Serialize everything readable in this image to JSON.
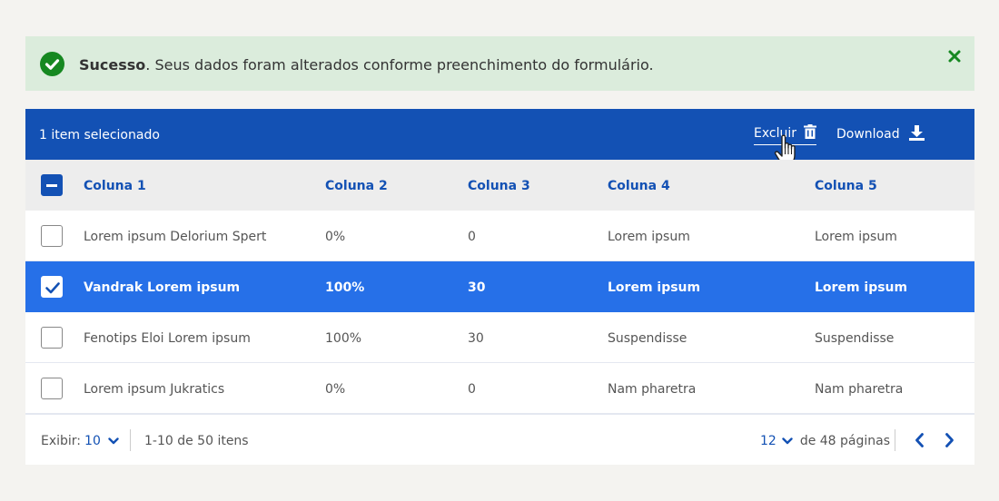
{
  "alert": {
    "title": "Sucesso",
    "message": ". Seus dados foram alterados conforme preenchimento do formulário."
  },
  "toolbar": {
    "selected_text": "1 item selecionado",
    "delete_label": "Excluir",
    "download_label": "Download"
  },
  "table": {
    "headers": [
      "Coluna 1",
      "Coluna 2",
      "Coluna 3",
      "Coluna 4",
      "Coluna 5"
    ],
    "rows": [
      {
        "cells": [
          "Lorem ipsum Delorium Spert",
          "0%",
          "0",
          "Lorem ipsum",
          "Lorem ipsum"
        ],
        "selected": false
      },
      {
        "cells": [
          "Vandrak Lorem ipsum",
          "100%",
          "30",
          "Lorem ipsum",
          "Lorem ipsum"
        ],
        "selected": true
      },
      {
        "cells": [
          "Fenotips Eloi Lorem ipsum",
          "100%",
          "30",
          "Suspendisse",
          "Suspendisse"
        ],
        "selected": false
      },
      {
        "cells": [
          "Lorem ipsum Jukratics",
          "0%",
          "0",
          "Nam pharetra",
          "Nam pharetra"
        ],
        "selected": false
      }
    ]
  },
  "footer": {
    "show_label": "Exibir:",
    "show_value": "10",
    "range_text": "1-10 de 50 itens",
    "page_value": "12",
    "page_total": "de 48 páginas"
  },
  "colors": {
    "primary": "#1351b4",
    "active_row": "#2670e8",
    "success": "#168821",
    "success_bg": "#dbecdc"
  }
}
